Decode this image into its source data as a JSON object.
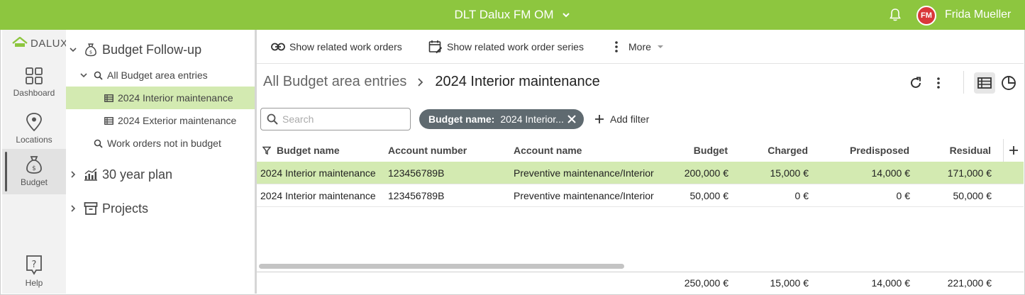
{
  "topbar": {
    "project_title": "DLT Dalux FM OM",
    "user_initials": "FM",
    "user_name": "Frida Mueller",
    "accent_color": "#8dc63f",
    "avatar_color": "#d9383a"
  },
  "rail": {
    "logo_text": "DALUX",
    "items": [
      {
        "label": "Dashboard",
        "icon": "grid-icon"
      },
      {
        "label": "Locations",
        "icon": "location-pin-icon"
      },
      {
        "label": "Budget",
        "icon": "money-bag-icon",
        "active": true
      },
      {
        "label": "Help",
        "icon": "help-icon"
      }
    ]
  },
  "tree": {
    "budget_followup": "Budget Follow-up",
    "all_entries": "All Budget area entries",
    "interior": "2024 Interior maintenance",
    "exterior": "2024 Exterior maintenance",
    "not_in_budget": "Work orders not in budget",
    "thirty_year": "30 year plan",
    "projects": "Projects"
  },
  "toolbar": {
    "related_orders": "Show related work orders",
    "related_series": "Show related work order series",
    "more": "More"
  },
  "breadcrumb": {
    "parent": "All Budget area entries",
    "current": "2024 Interior maintenance"
  },
  "filters": {
    "search_placeholder": "Search",
    "chip_key": "Budget name:",
    "chip_value": "2024 Interior...",
    "add_filter": "Add filter"
  },
  "table": {
    "headers": {
      "budget_name": "Budget name",
      "account_number": "Account number",
      "account_name": "Account name",
      "budget": "Budget",
      "charged": "Charged",
      "predisposed": "Predisposed",
      "residual": "Residual"
    },
    "rows": [
      {
        "budget_name": "2024 Interior maintenance",
        "account_number": "123456789B",
        "account_name": "Preventive maintenance/Interior",
        "budget": "200,000 €",
        "charged": "15,000 €",
        "predisposed": "14,000 €",
        "residual": "171,000 €",
        "selected": true
      },
      {
        "budget_name": "2024 Interior maintenance",
        "account_number": "123456789B",
        "account_name": "Preventive maintenance/Interior",
        "budget": "50,000 €",
        "charged": "0 €",
        "predisposed": "0 €",
        "residual": "50,000 €",
        "selected": false
      }
    ],
    "totals": {
      "budget": "250,000 €",
      "charged": "15,000 €",
      "predisposed": "14,000 €",
      "residual": "221,000 €"
    }
  }
}
